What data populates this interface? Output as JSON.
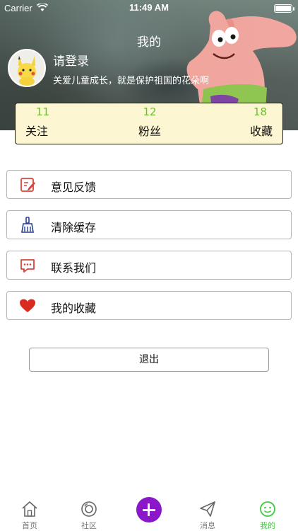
{
  "status_bar": {
    "carrier": "Carrier",
    "time": "11:49 AM"
  },
  "header": {
    "title": "我的",
    "login_label": "请登录",
    "slogan": "关爱儿童成长，就是保护祖国的花朵啊"
  },
  "stats": [
    {
      "value": "11",
      "label": "关注"
    },
    {
      "value": "12",
      "label": "粉丝"
    },
    {
      "value": "18",
      "label": "收藏"
    }
  ],
  "menu": [
    {
      "label": "意见反馈",
      "icon": "feedback-edit-icon"
    },
    {
      "label": "清除缓存",
      "icon": "broom-icon"
    },
    {
      "label": "联系我们",
      "icon": "chat-bubble-icon"
    },
    {
      "label": "我的收藏",
      "icon": "heart-icon"
    }
  ],
  "logout_label": "退出",
  "tabbar": {
    "items": [
      {
        "label": "首页",
        "icon": "home-icon"
      },
      {
        "label": "社区",
        "icon": "camera-lens-icon"
      },
      {
        "label": "",
        "icon": "plus-icon"
      },
      {
        "label": "消息",
        "icon": "paper-plane-icon"
      },
      {
        "label": "我的",
        "icon": "smiley-icon"
      }
    ],
    "active_index": 4
  },
  "colors": {
    "accent_green": "#3ecb3e",
    "stat_number_green": "#6bbf2a",
    "add_button_purple": "#8a18c9",
    "heart_red": "#d92b1f",
    "stats_card_bg": "#fdf6d2"
  }
}
